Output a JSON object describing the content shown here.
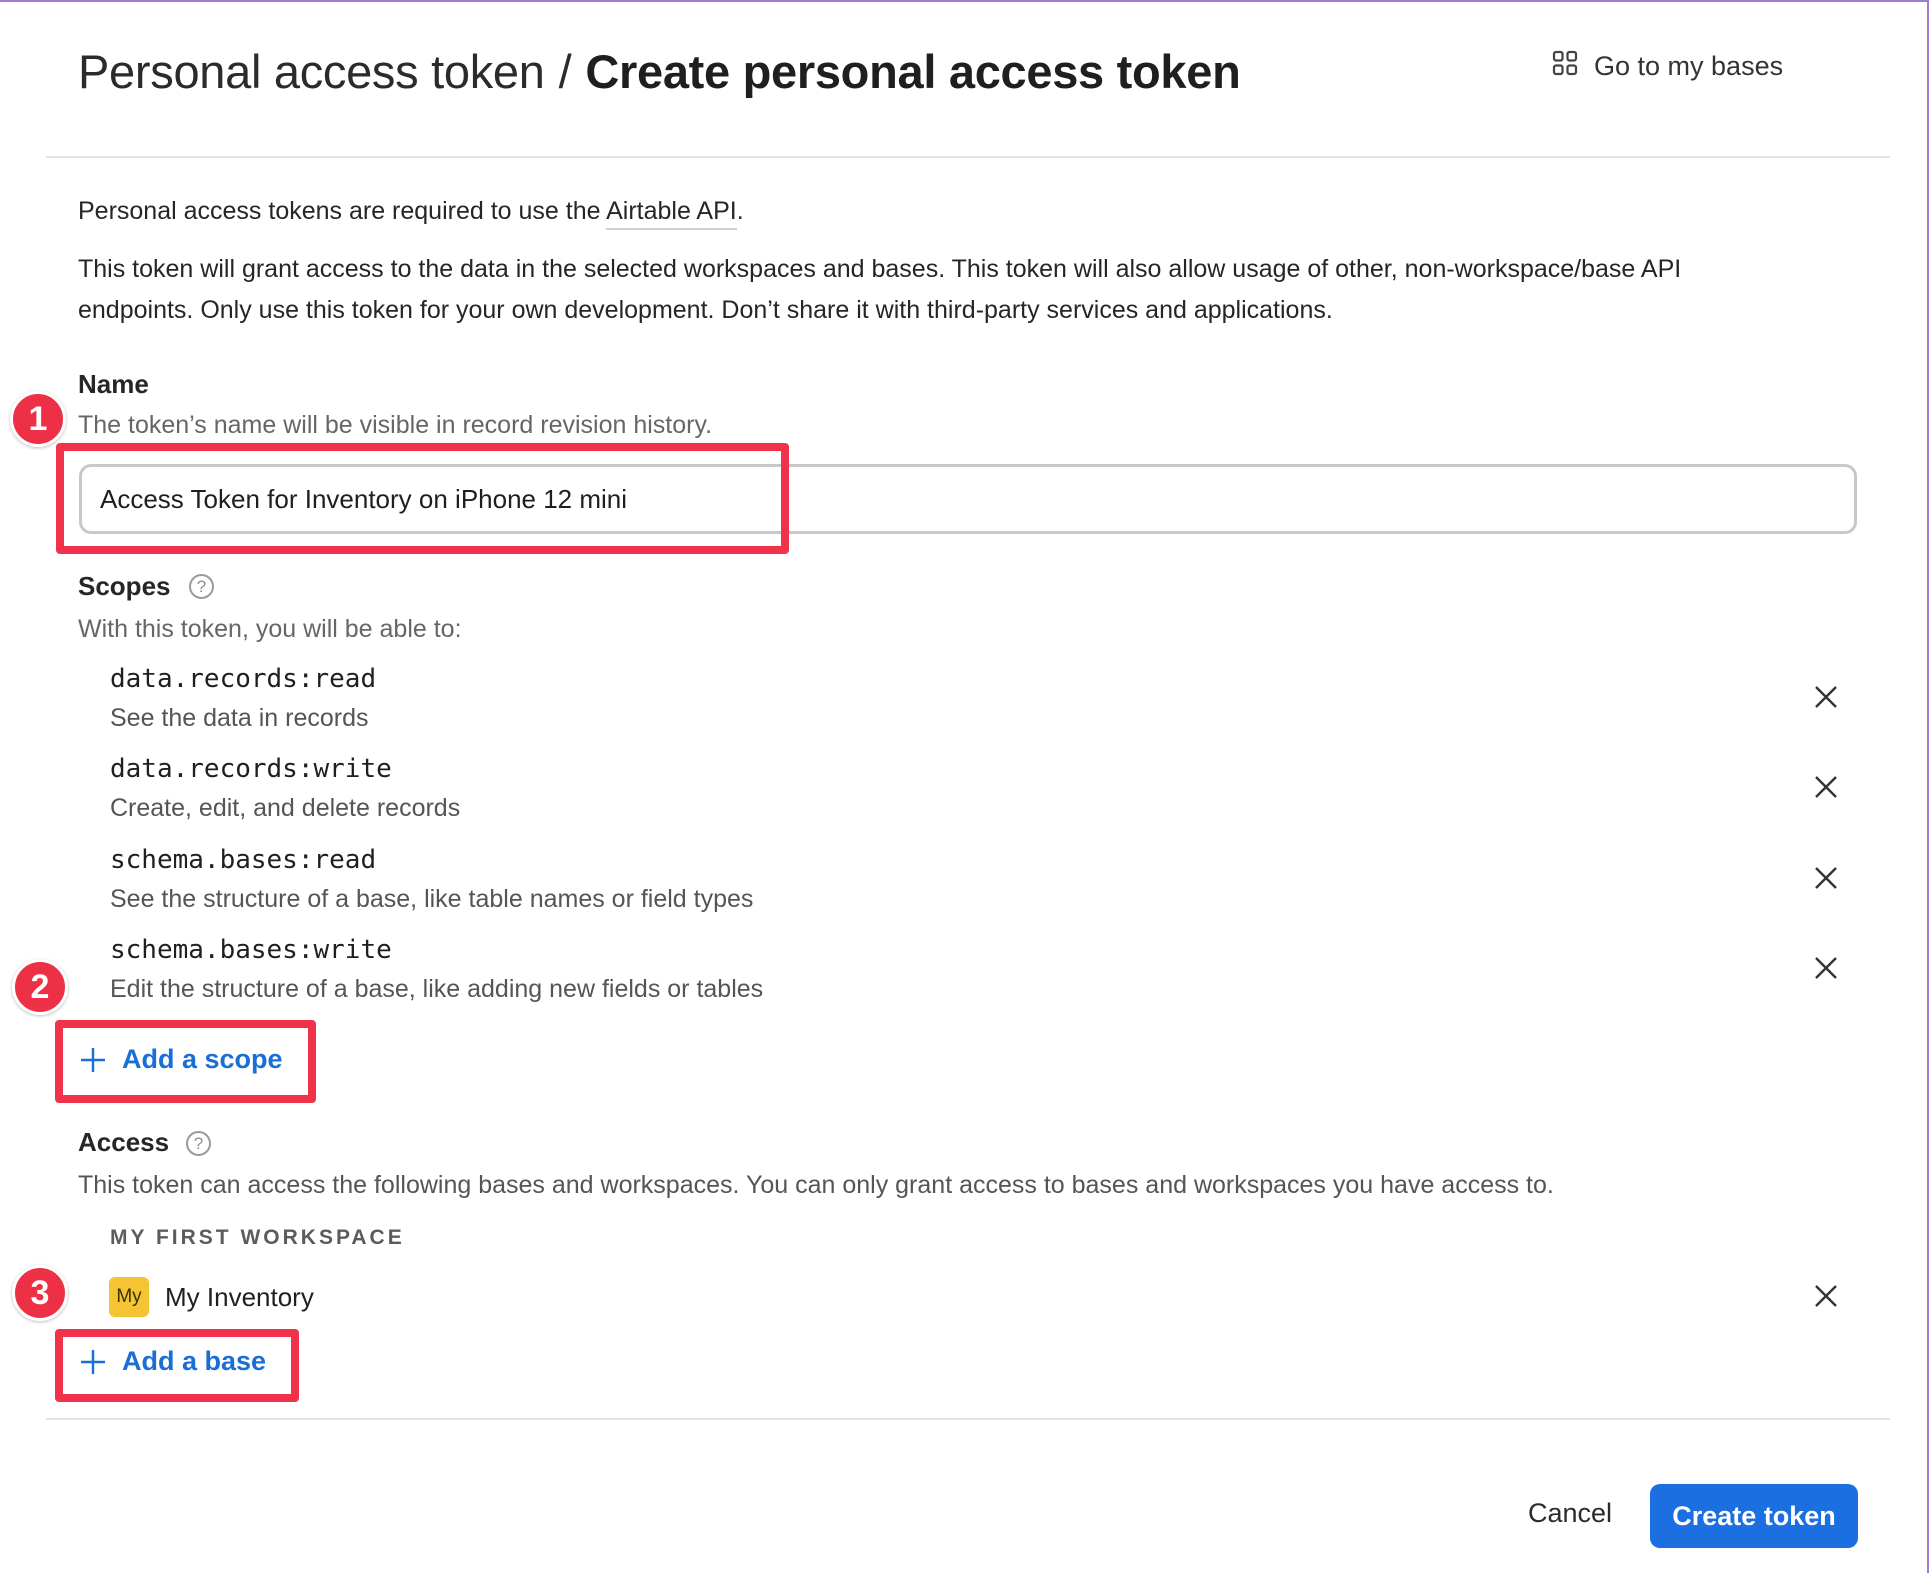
{
  "header": {
    "breadcrumb_parent": "Personal access token",
    "breadcrumb_separator": "/",
    "breadcrumb_current": "Create personal access token",
    "goto_bases_label": "Go to my bases"
  },
  "intro": {
    "line1_prefix": "Personal access tokens are required to use the ",
    "line1_link": "Airtable API",
    "line1_suffix": ".",
    "line2": "This token will grant access to the data in the selected workspaces and bases. This token will also allow usage of other, non-workspace/base API",
    "line3": "endpoints. Only use this token for your own development. Don’t share it with third-party services and applications."
  },
  "name_section": {
    "label": "Name",
    "hint": "The token’s name will be visible in record revision history.",
    "value": "Access Token for Inventory on iPhone 12 mini"
  },
  "scopes_section": {
    "label": "Scopes",
    "hint": "With this token, you will be able to:",
    "items": [
      {
        "code": "data.records:read",
        "desc": "See the data in records"
      },
      {
        "code": "data.records:write",
        "desc": "Create, edit, and delete records"
      },
      {
        "code": "schema.bases:read",
        "desc": "See the structure of a base, like table names or field types"
      },
      {
        "code": "schema.bases:write",
        "desc": "Edit the structure of a base, like adding new fields or tables"
      }
    ],
    "add_label": "Add a scope"
  },
  "access_section": {
    "label": "Access",
    "hint": "This token can access the following bases and workspaces. You can only grant access to bases and workspaces you have access to.",
    "workspace_label": "MY FIRST WORKSPACE",
    "base": {
      "avatar": "My",
      "name": "My Inventory"
    },
    "add_label": "Add a base"
  },
  "footer": {
    "cancel_label": "Cancel",
    "create_label": "Create token"
  },
  "annotations": {
    "badge1": "1",
    "badge2": "2",
    "badge3": "3"
  },
  "colors": {
    "primary_blue": "#1b6fe0",
    "link_blue": "#1a6fd6",
    "highlight_red": "#f0324b",
    "base_avatar_yellow": "#f4c433"
  }
}
